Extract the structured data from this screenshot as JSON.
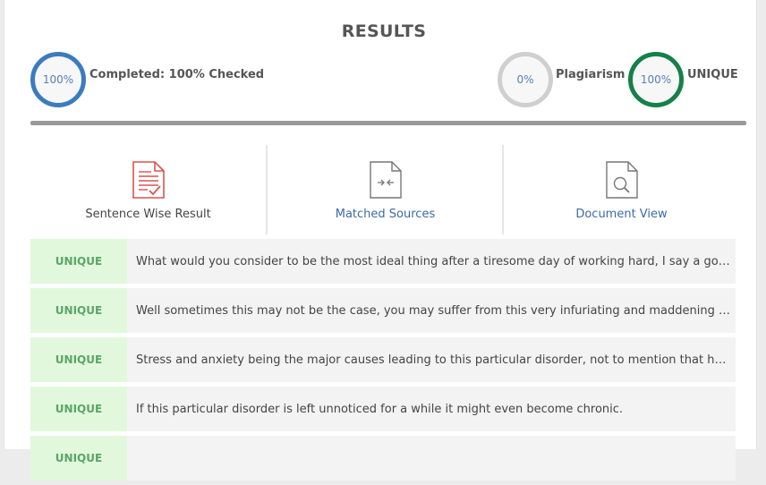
{
  "results": {
    "title": "RESULTS",
    "completed": {
      "value": "100%",
      "label": "Completed: 100% Checked"
    },
    "plagiarism": {
      "value": "0%",
      "label": "Plagiarism"
    },
    "unique": {
      "value": "100%",
      "label": "UNIQUE"
    }
  },
  "tabs": [
    {
      "label": "Sentence Wise Result",
      "icon": "document-check-icon"
    },
    {
      "label": "Matched Sources",
      "icon": "document-compare-icon"
    },
    {
      "label": "Document View",
      "icon": "document-search-icon"
    }
  ],
  "rows": [
    {
      "status": "UNIQUE",
      "text": "What would you consider to be the most ideal thing after a tiresome day of working hard, I say a good night's sleep"
    },
    {
      "status": "UNIQUE",
      "text": "Well sometimes this may not be the case, you may suffer from this very infuriating and maddening issue of insomnia"
    },
    {
      "status": "UNIQUE",
      "text": "Stress and anxiety being the major causes leading to this particular disorder, not to mention that having"
    },
    {
      "status": "UNIQUE",
      "text": "If this particular disorder is left unnoticed for a while it might even become chronic."
    },
    {
      "status": "UNIQUE",
      "text": ""
    }
  ],
  "colors": {
    "completed_ring": "#3c7bbf",
    "plagiarism_ring": "#cfcfcf",
    "unique_ring": "#16804a",
    "unique_badge_bg": "#e2f8dc",
    "unique_badge_text": "#5aa568",
    "link": "#3c6aa5"
  }
}
